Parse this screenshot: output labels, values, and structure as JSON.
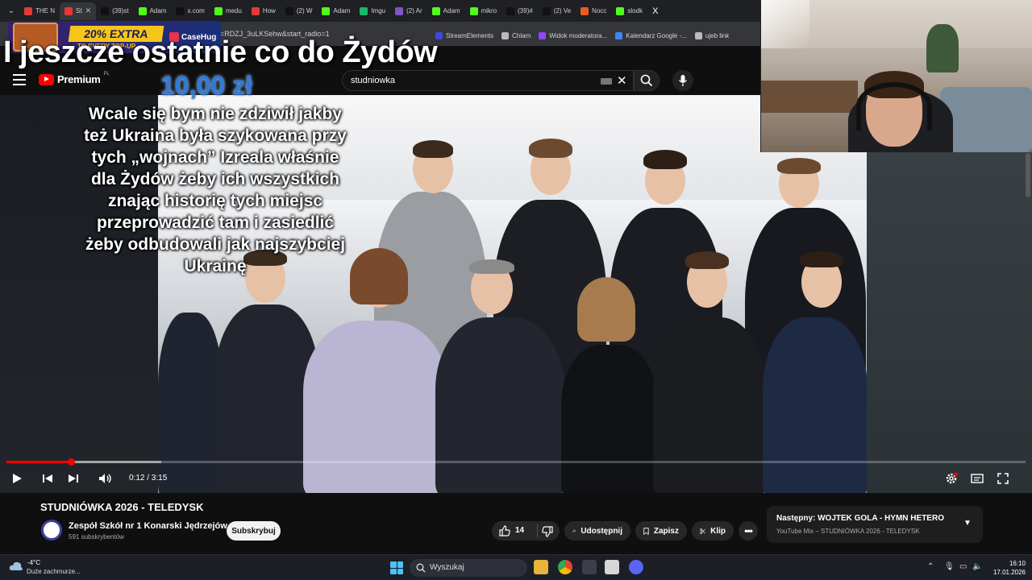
{
  "browser": {
    "tabs": [
      {
        "label": "THE N",
        "color": "#e53935"
      },
      {
        "label": "St",
        "color": "#e53935",
        "active": true
      },
      {
        "label": "(39)st",
        "color": "#111111"
      },
      {
        "label": "Adam",
        "color": "#53fc18"
      },
      {
        "label": "x.com",
        "color": "#111111"
      },
      {
        "label": "medu",
        "color": "#53fc18"
      },
      {
        "label": "How",
        "color": "#e53935"
      },
      {
        "label": "(2) W",
        "color": "#111111"
      },
      {
        "label": "Adam",
        "color": "#53fc18"
      },
      {
        "label": "Imgu",
        "color": "#1bb76e"
      },
      {
        "label": "(2) Ar",
        "color": "#7e57c2"
      },
      {
        "label": "Adam",
        "color": "#53fc18"
      },
      {
        "label": "mikro",
        "color": "#53fc18"
      },
      {
        "label": "(39)#",
        "color": "#111111"
      },
      {
        "label": "(2) Ve",
        "color": "#111111"
      },
      {
        "label": "Nocc",
        "color": "#e85d1f"
      },
      {
        "label": "slodk",
        "color": "#53fc18"
      }
    ],
    "url_fragment": "=RDZJ_3uLKSehw&start_radio=1",
    "bookmarks": [
      {
        "label": "StreamElements",
        "color": "#3b4bd8"
      },
      {
        "label": "Chlam",
        "color": "#bbbbbb"
      },
      {
        "label": "Widok moderatora...",
        "color": "#9146ff"
      },
      {
        "label": "Kalendarz Google -...",
        "color": "#4285f4"
      },
      {
        "label": "ujeb link",
        "color": "#bbbbbb"
      }
    ]
  },
  "ad": {
    "headline": "20% EXTRA",
    "subline": "TO EVERY TOP-UP",
    "brand": "CaseHug"
  },
  "youtube": {
    "logo_word": "Premium",
    "region": "PL",
    "search_query": "studniowka"
  },
  "overlay": {
    "title": "I jeszcze ostatnie co do Żydów",
    "donation_amount": "10,00 zł",
    "donation_message": "Wcale się bym nie zdziwił jakby też Ukraina była szykowana przy tych „wojnach” Izreala właśnie dla Żydów żeby ich wszystkich znając historię tych miejsc przeprowadzić tam i zasiedlić żeby odbudowali jak najszybciej Ukrainę"
  },
  "player": {
    "time": "0:12 / 3:15",
    "progress_fraction": 0.0615
  },
  "video": {
    "title": "STUDNIÓWKA 2026 - TELEDYSK",
    "channel": "Zespół Szkół nr 1 Konarski Jędrzejów",
    "subscribers": "591 subskrybentów",
    "subscribe_label": "Subskrybuj",
    "likes": "14",
    "share_label": "Udostępnij",
    "save_label": "Zapisz",
    "clip_label": "Klip"
  },
  "next_up": {
    "line1": "Następny: WOJTEK GOLA - HYMN HETERO",
    "line2": "YouTube Mix – STUDNIÓWKA 2026 - TELEDYSK"
  },
  "taskbar": {
    "temperature": "-4°C",
    "weather": "Duże zachmurze...",
    "search_label": "Wyszukaj",
    "time": "16:10",
    "date": "17.01.2026"
  },
  "colors": {
    "yt_red": "#ff0000",
    "win_accent": "#4cc2ff",
    "donation_blue": "#2f7bd8"
  }
}
